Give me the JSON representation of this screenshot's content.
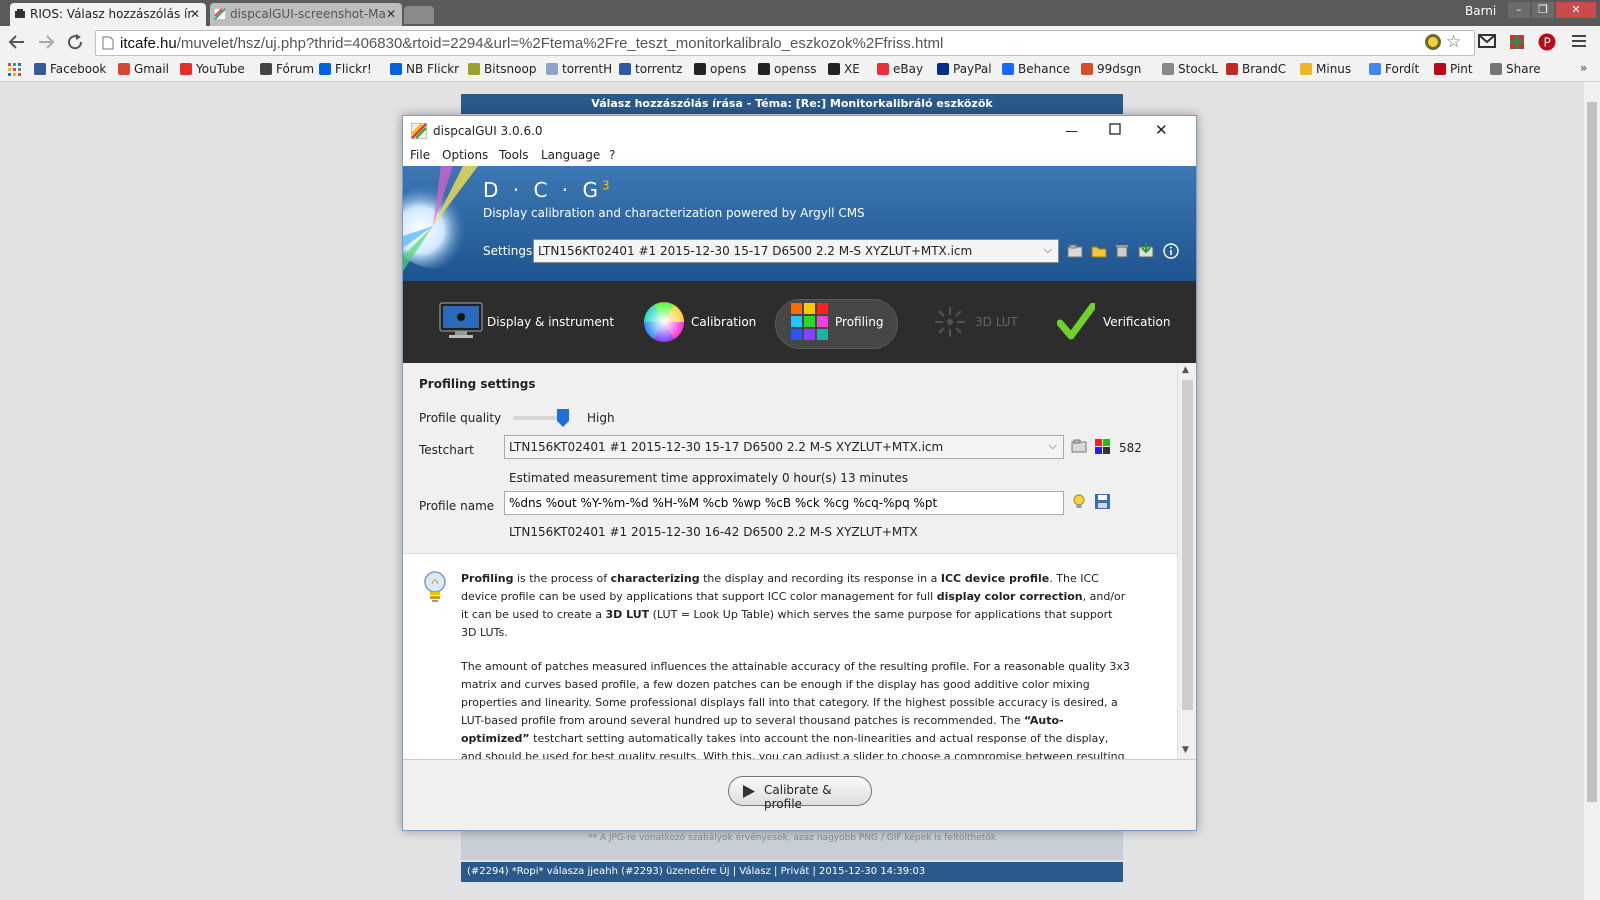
{
  "browser": {
    "tabs": [
      {
        "title": "RIOS: Válasz hozzászólás ír",
        "active": true
      },
      {
        "title": "dispcalGUI-screenshot-Ma",
        "active": false
      }
    ],
    "user": "Barni",
    "url_domain": "itcafe.hu",
    "url_path": "/muvelet/hsz/uj.php?thrid=406830&rtoid=2294&url=%2Ftema%2Fre_teszt_monitorkalibralo_eszkozok%2Ffriss.html",
    "bookmarks": [
      {
        "label": "Facebook",
        "color": "#3b5998"
      },
      {
        "label": "Gmail",
        "color": "#d44638"
      },
      {
        "label": "YouTube",
        "color": "#e52d27"
      },
      {
        "label": "Fórum",
        "color": "#444444"
      },
      {
        "label": "Flickr!",
        "color": "#0063dc"
      },
      {
        "label": "NB Flickr",
        "color": "#0063dc"
      },
      {
        "label": "Bitsnoop",
        "color": "#9aa02a"
      },
      {
        "label": "torrentH",
        "color": "#8fa3c8"
      },
      {
        "label": "torrentz",
        "color": "#2c5aa0"
      },
      {
        "label": "opens",
        "color": "#222222"
      },
      {
        "label": "openss",
        "color": "#222222"
      },
      {
        "label": "XE",
        "color": "#222222"
      },
      {
        "label": "eBay",
        "color": "#e53238"
      },
      {
        "label": "PayPal",
        "color": "#003087"
      },
      {
        "label": "Behance",
        "color": "#1769ff"
      },
      {
        "label": "99dsgn",
        "color": "#d94c2a"
      },
      {
        "label": "StockL",
        "color": "#888888"
      },
      {
        "label": "BrandC",
        "color": "#c62828"
      },
      {
        "label": "Minus",
        "color": "#f0b429"
      },
      {
        "label": "Fordít",
        "color": "#4285f4"
      },
      {
        "label": "Pint",
        "color": "#bd081c"
      },
      {
        "label": "Share",
        "color": "#777777"
      }
    ]
  },
  "page_behind": {
    "header": "Válasz hozzászólás írása - Téma: [Re:] Monitorkalibráló eszközök",
    "note": "** A JPG-re vonatkozó szabályok érvényesek, azaz nagyobb PNG / GIF képek is feltölthetők",
    "footer": "(#2294) *Ropi* válasza jjeahh (#2293) üzenetére      Új | Válasz | Privát | 2015-12-30 14:39:03"
  },
  "app": {
    "title": "dispcalGUI 3.0.6.0",
    "menu": [
      "File",
      "Options",
      "Tools",
      "Language",
      "?"
    ],
    "logo": "D · C · G",
    "logo_sup": "3",
    "tagline": "Display calibration and characterization powered by Argyll CMS",
    "settings_label": "Settings",
    "settings_value": "LTN156KT02401 #1 2015-12-30 15-17 D6500 2.2 M-S XYZLUT+MTX.icm",
    "tabs": [
      {
        "label": "Display & instrument",
        "active": false,
        "disabled": false
      },
      {
        "label": "Calibration",
        "active": false,
        "disabled": false
      },
      {
        "label": "Profiling",
        "active": true,
        "disabled": false
      },
      {
        "label": "3D LUT",
        "active": false,
        "disabled": true
      },
      {
        "label": "Verification",
        "active": false,
        "disabled": false
      }
    ],
    "profiling": {
      "heading": "Profiling settings",
      "quality_label": "Profile quality",
      "quality_value": "High",
      "quality_level": 1.0,
      "testchart_label": "Testchart",
      "testchart_value": "LTN156KT02401 #1 2015-12-30 15-17 D6500 2.2 M-S XYZLUT+MTX.icm",
      "patch_count": "582",
      "estimate": "Estimated measurement time approximately 0 hour(s) 13 minutes",
      "profile_name_label": "Profile name",
      "profile_name_value": "%dns %out %Y-%m-%d %H-%M %cb %wp %cB %ck %cg %cq-%pq %pt",
      "profile_name_preview": "LTN156KT02401 #1 2015-12-30 16-42 D6500 2.2 M-S XYZLUT+MTX"
    },
    "info": {
      "p1": [
        {
          "t": "Profiling",
          "b": true
        },
        {
          "t": " is the process of ",
          "b": false
        },
        {
          "t": "characterizing",
          "b": true
        },
        {
          "t": " the display and recording its response in a ",
          "b": false
        },
        {
          "t": "ICC device profile",
          "b": true
        },
        {
          "t": ". The ICC device profile can be used by applications that support ICC color management for full ",
          "b": false
        },
        {
          "t": "display color correction",
          "b": true
        },
        {
          "t": ", and/or it can be used to create a ",
          "b": false
        },
        {
          "t": "3D LUT",
          "b": true
        },
        {
          "t": " (LUT = Look Up Table) which serves the same purpose for applications that support 3D LUTs.",
          "b": false
        }
      ],
      "p2": [
        {
          "t": "The amount of patches measured influences the attainable accuracy of the resulting profile. For a reasonable quality 3x3 matrix and curves based profile, a few dozen patches can be enough if the display has good additive color mixing properties and linearity. Some professional displays fall into that category. If the highest possible accuracy is desired, a LUT-based profile from around several hundred up to several thousand patches is recommended. The ",
          "b": false
        },
        {
          "t": "“Auto-optimized”",
          "b": true
        },
        {
          "t": " testchart setting automatically takes into account the non-linearities and actual response of the display, and should be used for best quality results. With this, you can adjust a slider to choose a compromise between resulting profile accuracy and measurement as",
          "b": false
        }
      ]
    },
    "calibrate_button": "Calibrate & profile"
  }
}
